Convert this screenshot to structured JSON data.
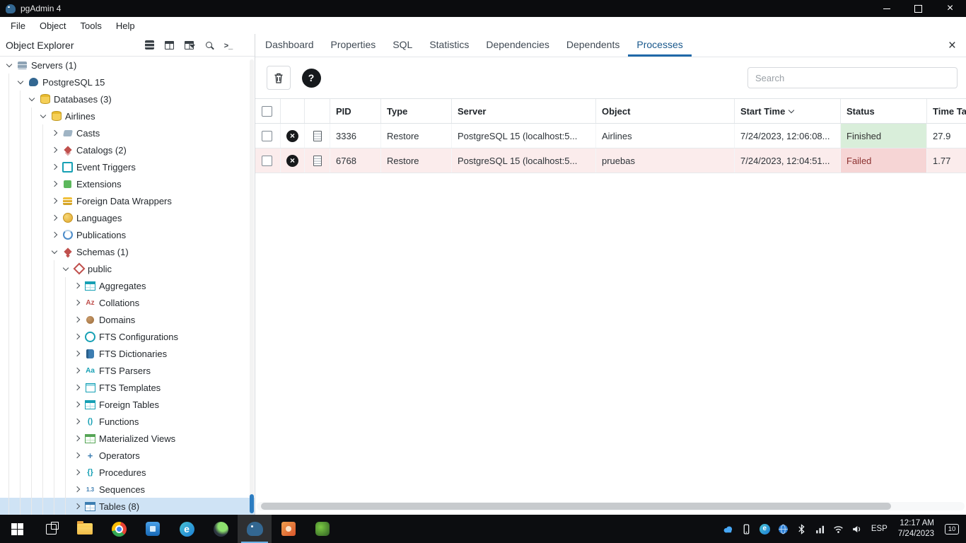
{
  "window": {
    "title": "pgAdmin 4"
  },
  "menu": {
    "items": [
      "File",
      "Object",
      "Tools",
      "Help"
    ]
  },
  "object_explorer": {
    "title": "Object Explorer",
    "icon_buttons": [
      "quick-connect-server",
      "view-data",
      "filtered-rows",
      "search-objects",
      "psql-tool"
    ],
    "tree": [
      {
        "label": "Servers (1)",
        "level": 0,
        "state": "expanded",
        "icon": "server"
      },
      {
        "label": "PostgreSQL 15",
        "level": 1,
        "state": "expanded",
        "icon": "postgres"
      },
      {
        "label": "Databases (3)",
        "level": 2,
        "state": "expanded",
        "icon": "database"
      },
      {
        "label": "Airlines",
        "level": 3,
        "state": "expanded",
        "icon": "database"
      },
      {
        "label": "Casts",
        "level": 4,
        "state": "collapsed",
        "icon": "cast"
      },
      {
        "label": "Catalogs (2)",
        "level": 4,
        "state": "collapsed",
        "icon": "catalog"
      },
      {
        "label": "Event Triggers",
        "level": 4,
        "state": "collapsed",
        "icon": "event-trigger"
      },
      {
        "label": "Extensions",
        "level": 4,
        "state": "collapsed",
        "icon": "extension"
      },
      {
        "label": "Foreign Data Wrappers",
        "level": 4,
        "state": "collapsed",
        "icon": "fdw"
      },
      {
        "label": "Languages",
        "level": 4,
        "state": "collapsed",
        "icon": "language"
      },
      {
        "label": "Publications",
        "level": 4,
        "state": "collapsed",
        "icon": "publication"
      },
      {
        "label": "Schemas (1)",
        "level": 4,
        "state": "expanded",
        "icon": "schema"
      },
      {
        "label": "public",
        "level": 5,
        "state": "expanded",
        "icon": "schema-public"
      },
      {
        "label": "Aggregates",
        "level": 6,
        "state": "collapsed",
        "icon": "aggregate"
      },
      {
        "label": "Collations",
        "level": 6,
        "state": "collapsed",
        "icon": "collation"
      },
      {
        "label": "Domains",
        "level": 6,
        "state": "collapsed",
        "icon": "domain"
      },
      {
        "label": "FTS Configurations",
        "level": 6,
        "state": "collapsed",
        "icon": "fts-config"
      },
      {
        "label": "FTS Dictionaries",
        "level": 6,
        "state": "collapsed",
        "icon": "fts-dict"
      },
      {
        "label": "FTS Parsers",
        "level": 6,
        "state": "collapsed",
        "icon": "fts-parser"
      },
      {
        "label": "FTS Templates",
        "level": 6,
        "state": "collapsed",
        "icon": "fts-template"
      },
      {
        "label": "Foreign Tables",
        "level": 6,
        "state": "collapsed",
        "icon": "foreign-table"
      },
      {
        "label": "Functions",
        "level": 6,
        "state": "collapsed",
        "icon": "function"
      },
      {
        "label": "Materialized Views",
        "level": 6,
        "state": "collapsed",
        "icon": "matview"
      },
      {
        "label": "Operators",
        "level": 6,
        "state": "collapsed",
        "icon": "operator"
      },
      {
        "label": "Procedures",
        "level": 6,
        "state": "collapsed",
        "icon": "procedure"
      },
      {
        "label": "Sequences",
        "level": 6,
        "state": "collapsed",
        "icon": "sequence"
      },
      {
        "label": "Tables (8)",
        "level": 6,
        "state": "collapsed",
        "icon": "table",
        "selected": true
      }
    ]
  },
  "main": {
    "tabs": [
      {
        "label": "Dashboard",
        "active": false
      },
      {
        "label": "Properties",
        "active": false
      },
      {
        "label": "SQL",
        "active": false
      },
      {
        "label": "Statistics",
        "active": false
      },
      {
        "label": "Dependencies",
        "active": false
      },
      {
        "label": "Dependents",
        "active": false
      },
      {
        "label": "Processes",
        "active": true
      }
    ],
    "toolbar": {
      "search_placeholder": "Search"
    },
    "table": {
      "columns": [
        "PID",
        "Type",
        "Server",
        "Object",
        "Start Time",
        "Status",
        "Time Taken"
      ],
      "rows": [
        {
          "pid": "3336",
          "type": "Restore",
          "server": "PostgreSQL 15 (localhost:5...",
          "object": "Airlines",
          "start_time": "7/24/2023, 12:06:08...",
          "status": "Finished",
          "time_taken": "27.9"
        },
        {
          "pid": "6768",
          "type": "Restore",
          "server": "PostgreSQL 15 (localhost:5...",
          "object": "pruebas",
          "start_time": "7/24/2023, 12:04:51...",
          "status": "Failed",
          "time_taken": "1.77"
        }
      ]
    }
  },
  "taskbar": {
    "language": "ESP",
    "time": "12:17 AM",
    "date": "7/24/2023",
    "notification_count": "10"
  }
}
